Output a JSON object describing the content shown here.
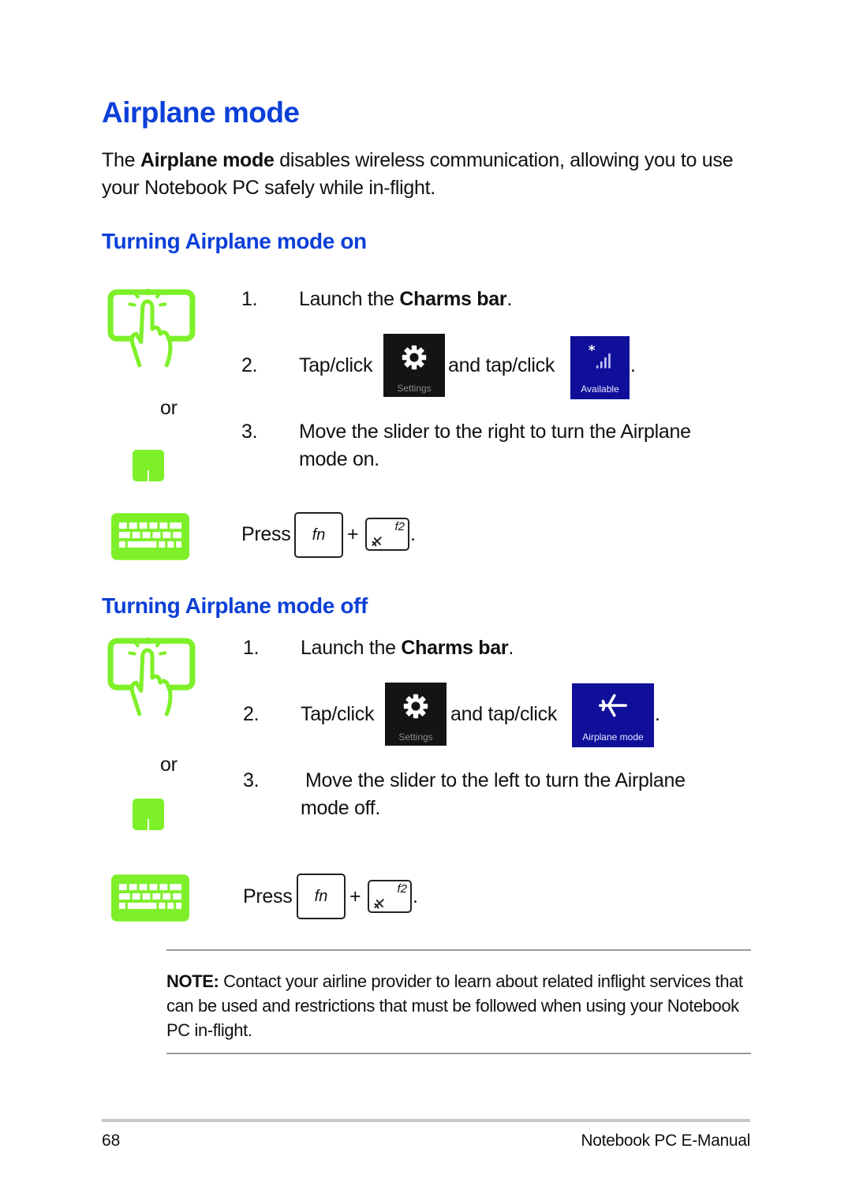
{
  "page": {
    "title": "Airplane mode",
    "intro": {
      "prefix": "The ",
      "bold": "Airplane mode",
      "suffix": " disables wireless communication, allowing you to use your Notebook PC safely while in-flight."
    },
    "icons": {
      "touch": "tap-touchscreen-icon",
      "touchpad": "touchpad-icon",
      "keyboard": "keyboard-icon",
      "settings": "gear-icon",
      "network": "signal-bars-icon",
      "airplane": "airplane-icon"
    },
    "colors": {
      "heading": "#0c3fd8",
      "icon_green": "#7ef02a",
      "tile_dark": "#141414",
      "tile_blue": "#0f0f9a"
    },
    "or_label": "or",
    "sections": [
      {
        "heading": "Turning Airplane mode on",
        "steps": [
          {
            "num": "1.",
            "prefix": "Launch the ",
            "bold": "Charms bar",
            "suffix": "."
          },
          {
            "num": "2.",
            "tap": "Tap/click",
            "and_tap": "and tap/click",
            "tile1_label": "Settings",
            "tile2_label": "Available",
            "end": "."
          },
          {
            "num": "3.",
            "line1": "Move the slider to the right to turn the Airplane",
            "line2": "mode on."
          }
        ],
        "press": {
          "label": "Press",
          "key1": "fn",
          "plus": "+",
          "key2": "f2",
          "end": "."
        }
      },
      {
        "heading": "Turning Airplane mode off",
        "steps": [
          {
            "num": "1.",
            "prefix": "Launch the ",
            "bold": "Charms bar",
            "suffix": "."
          },
          {
            "num": "2.",
            "tap": "Tap/click",
            "and_tap": "and tap/click",
            "tile1_label": "Settings",
            "tile2_label": "Airplane mode",
            "end": "."
          },
          {
            "num": "3.",
            "line1": "Move the slider to the left to turn the Airplane",
            "line2": "mode off."
          }
        ],
        "press": {
          "label": "Press",
          "key1": "fn",
          "plus": "+",
          "key2": "f2",
          "end": "."
        }
      }
    ],
    "note": {
      "label": "NOTE:",
      "text": " Contact your airline provider to learn about related inflight services that can be used and restrictions that must be followed when using your Notebook PC in-flight."
    },
    "footer": {
      "page_number": "68",
      "doc_title": "Notebook PC E-Manual"
    }
  }
}
